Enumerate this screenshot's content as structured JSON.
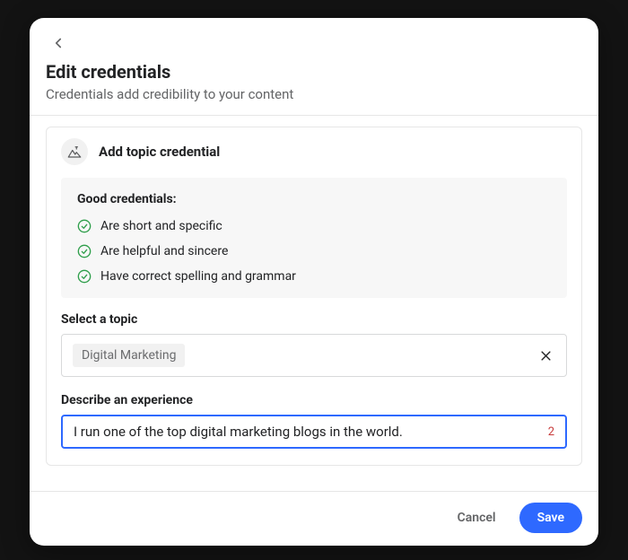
{
  "header": {
    "title": "Edit credentials",
    "subtitle": "Credentials add credibility to your content"
  },
  "card": {
    "title": "Add topic credential"
  },
  "tips": {
    "title": "Good credentials:",
    "items": [
      "Are short and specific",
      "Are helpful and sincere",
      "Have correct spelling and grammar"
    ]
  },
  "topic": {
    "label": "Select a topic",
    "chip": "Digital Marketing"
  },
  "experience": {
    "label": "Describe an experience",
    "value": "I run one of the top digital marketing blogs in the world.",
    "counter": "2"
  },
  "footer": {
    "cancel": "Cancel",
    "save": "Save"
  }
}
